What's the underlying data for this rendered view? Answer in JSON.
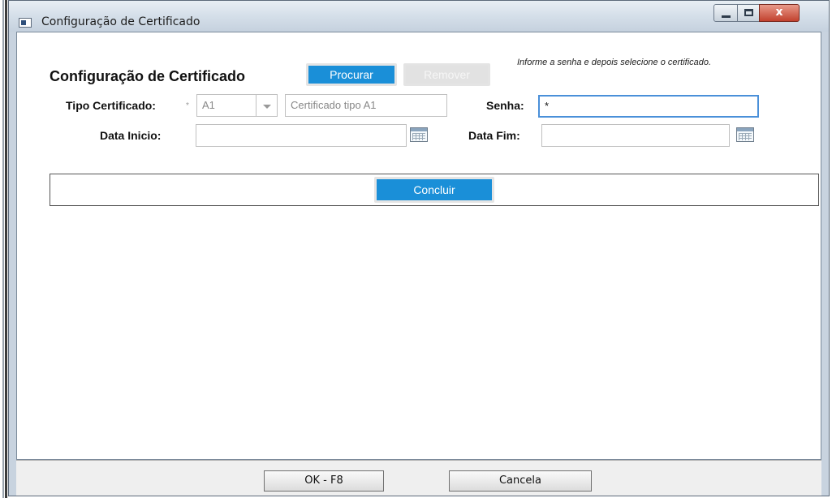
{
  "window": {
    "title": "Configuração de Certificado",
    "controls": {
      "close_label": "x"
    }
  },
  "form": {
    "heading": "Configuração de Certificado",
    "procurar_label": "Procurar",
    "remover_label": "Remover",
    "hint": "Informe a senha e depois selecione o certificado.",
    "tipo_label": "Tipo Certificado:",
    "required_marker": "*",
    "tipo_value": "A1",
    "tipo_description": "Certificado tipo A1",
    "senha_label": "Senha:",
    "senha_value": "*",
    "data_inicio_label": "Data Inicio:",
    "data_inicio_value": "",
    "data_fim_label": "Data Fim:",
    "data_fim_value": "",
    "concluir_label": "Concluir"
  },
  "footer": {
    "ok_label": "OK - F8",
    "cancela_label": "Cancela"
  },
  "colors": {
    "accent_blue": "#1a8fd8",
    "close_red": "#c2412e"
  },
  "icons": [
    "window-app-icon",
    "minimize-icon",
    "maximize-icon",
    "close-icon",
    "dropdown-arrow-icon",
    "calendar-icon"
  ]
}
